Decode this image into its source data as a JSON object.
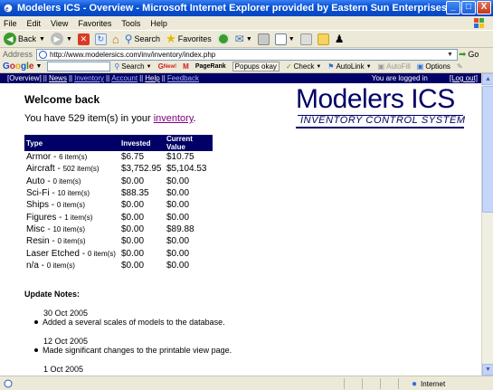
{
  "window": {
    "title": "Modelers ICS - Overview - Microsoft Internet Explorer provided by Eastern Sun Enterprises, Inc",
    "buttons": [
      "_",
      "□",
      "X"
    ]
  },
  "menu": [
    "File",
    "Edit",
    "View",
    "Favorites",
    "Tools",
    "Help"
  ],
  "toolbar": {
    "back": "Back",
    "search": "Search",
    "favorites": "Favorites"
  },
  "address": {
    "label": "Address",
    "url": "http://www.modelersics.com/inv/inventory/index.php",
    "go": "Go"
  },
  "googlebar": {
    "logo": [
      "G",
      "o",
      "o",
      "g",
      "l",
      "e"
    ],
    "search": "Search",
    "new_badge": "New!",
    "pagerank": "PageRank",
    "popups": "Popups okay",
    "check": "Check",
    "autolink": "AutoLink",
    "autofill": "AutoFill",
    "options": "Options"
  },
  "nav": {
    "links": [
      "[Overview]",
      "News",
      "Inventory",
      "Account",
      "Help",
      "Feedback"
    ],
    "logged_in": "You are logged in",
    "logout": "[Log out]"
  },
  "page": {
    "welcome": "Welcome back",
    "have_prefix": "You have 529 item(s) in your",
    "inventory_link": "inventory",
    "have_suffix": "."
  },
  "logo": {
    "title": "Modelers ICS",
    "subtitle": "INVENTORY CONTROL SYSTEM"
  },
  "table": {
    "headers": [
      "Type",
      "Invested",
      "Current Value"
    ],
    "rows": [
      {
        "type": "Armor",
        "count": "6 item(s)",
        "invested": "$6.75",
        "current": "$10.75"
      },
      {
        "type": "Aircraft",
        "count": "502 item(s)",
        "invested": "$3,752.95",
        "current": "$5,104.53"
      },
      {
        "type": "Auto",
        "count": "0 item(s)",
        "invested": "$0.00",
        "current": "$0.00"
      },
      {
        "type": "Sci-Fi",
        "count": "10 item(s)",
        "invested": "$88.35",
        "current": "$0.00"
      },
      {
        "type": "Ships",
        "count": "0 item(s)",
        "invested": "$0.00",
        "current": "$0.00"
      },
      {
        "type": "Figures",
        "count": "1 item(s)",
        "invested": "$0.00",
        "current": "$0.00"
      },
      {
        "type": "Misc",
        "count": "10 item(s)",
        "invested": "$0.00",
        "current": "$89.88"
      },
      {
        "type": "Resin",
        "count": "0 item(s)",
        "invested": "$0.00",
        "current": "$0.00"
      },
      {
        "type": "Laser Etched",
        "count": "0 item(s)",
        "invested": "$0.00",
        "current": "$0.00"
      },
      {
        "type": "n/a",
        "count": "0 item(s)",
        "invested": "$0.00",
        "current": "$0.00"
      }
    ]
  },
  "updates": {
    "heading": "Update Notes:",
    "entries": [
      {
        "date": "30 Oct 2005",
        "text": "Added a several scales of models to the database."
      },
      {
        "date": "12 Oct 2005",
        "text": "Made significant changes to the printable view page."
      },
      {
        "date": "1 Oct 2005",
        "text": ""
      }
    ]
  },
  "status": {
    "zone": "Internet"
  }
}
